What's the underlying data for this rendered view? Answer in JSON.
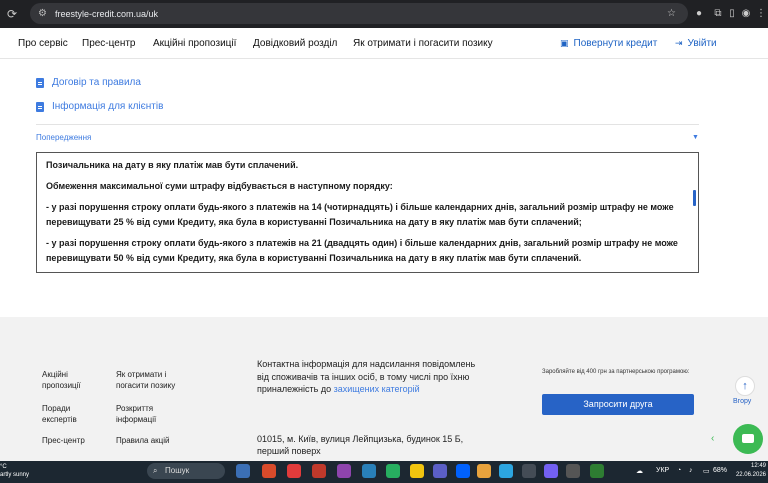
{
  "browser": {
    "url": "freestyle-credit.com.ua/uk"
  },
  "header": {
    "nav": [
      "Про сервіс",
      "Прес-центр",
      "Акційні пропозиції",
      "Довідковий розділ",
      "Як отримати і погасити позику"
    ],
    "return_credit": "Повернути кредит",
    "login": "Увійти"
  },
  "documents": {
    "links": [
      "Договір та правила",
      "Інформація для клієнтів"
    ]
  },
  "warning": {
    "title": "Попередження",
    "paragraphs": [
      "Позичальника на дату в яку платіж мав бути сплачений.",
      "Обмеження максимальної суми штрафу відбувається в наступному порядку:",
      "- у разі порушення строку оплати будь-якого з платежів на 14 (чотирнадцять) і більше календарних днів, загальний розмір штрафу не може перевищувати 25 % від суми Кредиту, яка була в користуванні Позичальника на дату в яку платіж мав бути сплачений;",
      "- у разі порушення строку оплати будь-якого з платежів на 21 (двадцять один) і більше календарних днів, загальний розмір штрафу не може перевищувати 50 % від суми Кредиту, яка була в користуванні Позичальника на дату в яку платіж мав бути сплачений."
    ]
  },
  "footer": {
    "col1": [
      "Акційні пропозиції",
      "Поради експертів",
      "Прес-центр"
    ],
    "col2": [
      "Як отримати і погасити позику",
      "Розкриття інформації",
      "Правила акцій"
    ],
    "contact_text": "Контактна інформація для надсилання повідомлень від споживачів та інших осіб, в тому числі про їхню приналежність до",
    "contact_link": "захищених категорій",
    "address": "01015, м. Київ, вулиця Лейпцизька, будинок 15 Б, перший поверх",
    "promo": "Заробляйте від 400 грн за партнерською програмою:",
    "invite_button": "Запросити друга",
    "up_label": "Вгору"
  },
  "taskbar": {
    "weather_temp": "°C",
    "weather_desc": "artly sunny",
    "search_placeholder": "Пошук",
    "language": "УКР",
    "battery": "68%",
    "time": "12:49",
    "date": "22.06.2026"
  }
}
